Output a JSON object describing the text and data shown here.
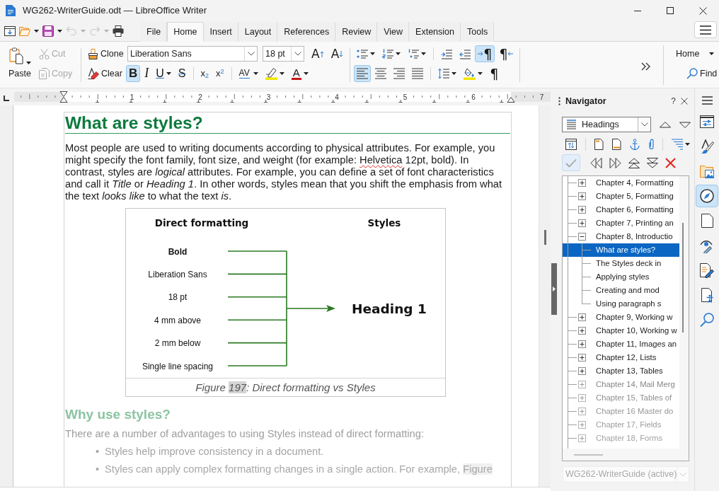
{
  "window": {
    "title": "WG262-WriterGuide.odt — LibreOffice Writer"
  },
  "quick_access": [
    {
      "kind": "new",
      "disabled": false,
      "has_menu": false
    },
    {
      "kind": "open",
      "disabled": false,
      "has_menu": true
    },
    {
      "kind": "save",
      "disabled": false,
      "has_menu": true
    },
    {
      "kind": "undo",
      "disabled": true,
      "has_menu": true
    },
    {
      "kind": "redo",
      "disabled": true,
      "has_menu": true
    },
    {
      "kind": "print",
      "disabled": false,
      "has_menu": false
    }
  ],
  "tabs": [
    {
      "label": "File",
      "selected": false
    },
    {
      "label": "Home",
      "selected": true
    },
    {
      "label": "Insert",
      "selected": false
    },
    {
      "label": "Layout",
      "selected": false
    },
    {
      "label": "References",
      "selected": false
    },
    {
      "label": "Review",
      "selected": false
    },
    {
      "label": "View",
      "selected": false
    },
    {
      "label": "Extension",
      "selected": false
    },
    {
      "label": "Tools",
      "selected": false
    }
  ],
  "ribbon": {
    "paste": {
      "label": "Paste"
    },
    "cut": {
      "label": "Cut",
      "disabled": true
    },
    "copy": {
      "label": "Copy",
      "disabled": true
    },
    "clone": {
      "label": "Clone"
    },
    "clear": {
      "label": "Clear"
    },
    "font_name": {
      "value": "Liberation Sans"
    },
    "font_size": {
      "value": "18 pt"
    },
    "grow_font": {
      "label": "A"
    },
    "shrink_font": {
      "label": "A"
    },
    "character_tools": [
      {
        "kind": "bold",
        "label": "B",
        "selected": true,
        "has_menu": false
      },
      {
        "kind": "italic",
        "label": "I",
        "selected": false,
        "has_menu": false
      },
      {
        "kind": "underline",
        "label": "U",
        "selected": false,
        "has_menu": true
      },
      {
        "kind": "strikethrough",
        "label": "S",
        "selected": false,
        "has_menu": false
      },
      {
        "kind": "separator"
      },
      {
        "kind": "subscript",
        "label": "x$_{2}$",
        "selected": false,
        "has_menu": false
      },
      {
        "kind": "superscript",
        "label": "x$^{2}$",
        "selected": false,
        "has_menu": false
      },
      {
        "kind": "separator"
      },
      {
        "kind": "spacing",
        "label": "AV",
        "selected": false,
        "has_menu": true
      },
      {
        "kind": "highlight",
        "selected": false,
        "has_menu": true
      },
      {
        "kind": "font_color",
        "label": "A",
        "selected": false,
        "has_menu": true
      }
    ],
    "list_tools": [
      {
        "kind": "bullets",
        "selected": false,
        "has_menu": true
      },
      {
        "kind": "numbering",
        "selected": false,
        "has_menu": true
      },
      {
        "kind": "outline",
        "selected": false,
        "has_menu": true
      },
      {
        "kind": "separator"
      },
      {
        "kind": "indent",
        "selected": false,
        "has_menu": false
      },
      {
        "kind": "outdent",
        "selected": false,
        "has_menu": false
      },
      {
        "kind": "ltr",
        "label": "¶",
        "selected": true,
        "has_menu": false
      },
      {
        "kind": "rtl",
        "label": "¶",
        "selected": false,
        "has_menu": false
      }
    ],
    "paragraph_tools": [
      {
        "kind": "align_left",
        "selected": true,
        "has_menu": false
      },
      {
        "kind": "align_center",
        "selected": false,
        "has_menu": false
      },
      {
        "kind": "align_right",
        "selected": false,
        "has_menu": false
      },
      {
        "kind": "justify",
        "selected": false,
        "has_menu": false
      },
      {
        "kind": "separator"
      },
      {
        "kind": "line_spacing",
        "selected": false,
        "has_menu": true
      },
      {
        "kind": "paragraph_background",
        "selected": false,
        "has_menu": true
      },
      {
        "kind": "formatting_marks",
        "label": "¶",
        "selected": false,
        "has_menu": false
      }
    ],
    "tab_menu": {
      "label": "Home"
    },
    "find": {
      "label": "Find"
    }
  },
  "document": {
    "ruler": {
      "numbers": [
        "1",
        "2",
        "3",
        "4",
        "5",
        "6",
        "7"
      ]
    },
    "blocks": [
      {
        "kind": "heading1",
        "text": "What are styles?",
        "faded": false
      },
      {
        "kind": "paragraph",
        "faded": false,
        "runs": [
          {
            "kind": "text",
            "text": "Most people are used to writing documents according to physical attributes. For example, you might specify the font family, font size, and weight (for example: "
          },
          {
            "kind": "misspelled",
            "text": "Helvetica"
          },
          {
            "kind": "text",
            "text": " 12pt, bold). In contrast, styles are *logical* attributes. For example, you can define a set of font characteristics and call it *Title* or *Heading 1*. In other words, styles mean that you shift the emphasis from what the text *looks like* to what the text *is*."
          }
        ]
      },
      {
        "kind": "figure",
        "left_title": "Direct formatting",
        "right_title": "Styles",
        "attributes": [
          {
            "text": "Bold",
            "bold": true
          },
          {
            "text": "Liberation Sans",
            "bold": false
          },
          {
            "text": "18 pt",
            "bold": false
          },
          {
            "text": "4 mm above",
            "bold": false
          },
          {
            "text": "2 mm below",
            "bold": false
          },
          {
            "text": "Single line spacing",
            "bold": false
          }
        ],
        "result": "Heading 1",
        "caption": [
          {
            "kind": "text",
            "text": "Figure "
          },
          {
            "kind": "field",
            "text": "197"
          },
          {
            "kind": "text",
            "text": ": Direct formatting vs Styles"
          }
        ]
      },
      {
        "kind": "heading2",
        "text": "Why use styles?",
        "faded": true
      },
      {
        "kind": "paragraph",
        "faded": true,
        "runs": [
          {
            "kind": "text",
            "text": "There are a number of advantages to using Styles instead of direct formatting:"
          }
        ]
      },
      {
        "kind": "bullet",
        "bullet": "•",
        "faded": true,
        "runs": [
          {
            "kind": "text",
            "text": "Styles help improve consistency in a document."
          }
        ]
      },
      {
        "kind": "bullet",
        "bullet": "•",
        "faded": true,
        "runs": [
          {
            "kind": "text",
            "text": "Styles can apply complex formatting changes in a single action. For example, "
          },
          {
            "kind": "field",
            "text": "Figure"
          }
        ]
      }
    ]
  },
  "navigator": {
    "title": "Navigator",
    "help": {
      "label": "?"
    },
    "content_type": {
      "value": "Headings"
    },
    "tools": [
      {
        "kind": "toggle"
      },
      {
        "kind": "separator"
      },
      {
        "kind": "header"
      },
      {
        "kind": "footer"
      },
      {
        "kind": "anchor"
      },
      {
        "kind": "attachment"
      },
      {
        "kind": "separator"
      },
      {
        "kind": "heading_levels"
      }
    ],
    "outline_tools": [
      {
        "kind": "drag_mode",
        "selected": true,
        "disabled": true
      },
      {
        "kind": "promote_chapter",
        "selected": false,
        "disabled": false
      },
      {
        "kind": "demote_chapter",
        "selected": false,
        "disabled": false
      },
      {
        "kind": "promote_level",
        "selected": false,
        "disabled": false
      },
      {
        "kind": "demote_level",
        "selected": false,
        "disabled": false
      },
      {
        "kind": "delete",
        "selected": false,
        "disabled": false
      }
    ],
    "tree": [
      {
        "label": "Chapter 4, Formatting",
        "expanded": false,
        "selected": false,
        "faded": false
      },
      {
        "label": "Chapter 5, Formatting",
        "expanded": false,
        "selected": false,
        "faded": false
      },
      {
        "label": "Chapter 6, Formatting",
        "expanded": false,
        "selected": false,
        "faded": false
      },
      {
        "label": "Chapter 7, Printing an",
        "expanded": false,
        "selected": false,
        "faded": false
      },
      {
        "label": "Chapter 8, Introductio",
        "expanded": true,
        "selected": false,
        "faded": false,
        "children": [
          {
            "label": "What are styles?",
            "selected": true,
            "faded": false
          },
          {
            "label": "The Styles deck in",
            "selected": false,
            "faded": false
          },
          {
            "label": "Applying styles",
            "selected": false,
            "faded": false
          },
          {
            "label": "Creating and mod",
            "selected": false,
            "faded": false
          },
          {
            "label": "Using paragraph s",
            "selected": false,
            "faded": false
          }
        ]
      },
      {
        "label": "Chapter 9, Working w",
        "expanded": false,
        "selected": false,
        "faded": false
      },
      {
        "label": "Chapter 10, Working w",
        "expanded": false,
        "selected": false,
        "faded": false
      },
      {
        "label": "Chapter 11, Images an",
        "expanded": false,
        "selected": false,
        "faded": false
      },
      {
        "label": "Chapter 12, Lists",
        "expanded": false,
        "selected": false,
        "faded": false
      },
      {
        "label": "Chapter 13, Tables",
        "expanded": false,
        "selected": false,
        "faded": false
      },
      {
        "label": "Chapter 14, Mail Merg",
        "expanded": false,
        "selected": false,
        "faded": true
      },
      {
        "label": "Chapter 15, Tables of",
        "expanded": false,
        "selected": false,
        "faded": true
      },
      {
        "label": "Chapter 16 Master do",
        "expanded": false,
        "selected": false,
        "faded": true
      },
      {
        "label": "Chapter 17, Fields",
        "expanded": false,
        "selected": false,
        "faded": true
      },
      {
        "label": "Chapter 18, Forms",
        "expanded": false,
        "selected": false,
        "faded": true
      }
    ],
    "document": {
      "value": "WG262-WriterGuide (active)",
      "faded": true
    }
  },
  "sidebar_tabs": [
    {
      "kind": "properties",
      "selected": false
    },
    {
      "kind": "styles",
      "selected": false
    },
    {
      "kind": "gallery",
      "selected": false
    },
    {
      "kind": "navigator",
      "selected": true
    },
    {
      "kind": "page",
      "selected": false
    },
    {
      "kind": "manage_changes",
      "selected": false
    },
    {
      "kind": "inspector",
      "selected": false
    },
    {
      "kind": "accessibility",
      "selected": false
    },
    {
      "kind": "find",
      "selected": false
    }
  ]
}
